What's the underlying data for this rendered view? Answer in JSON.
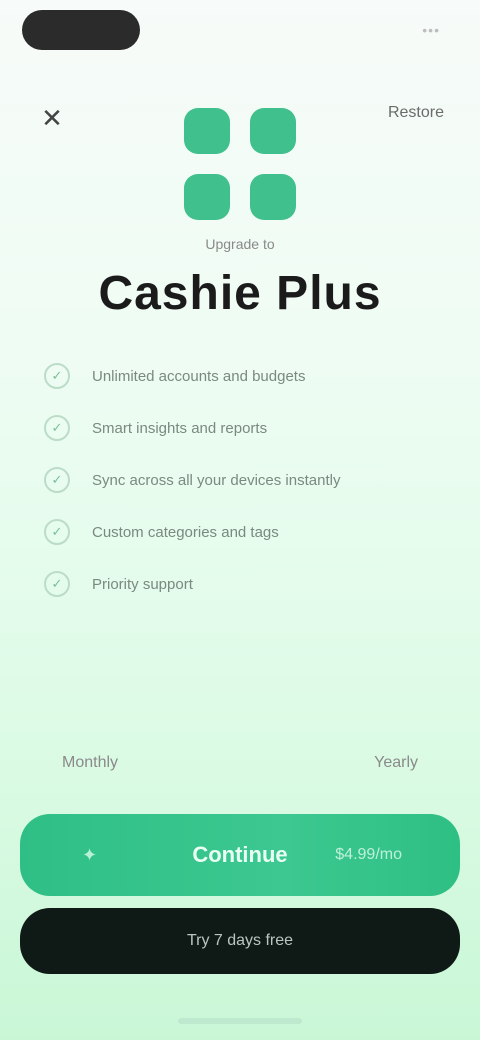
{
  "status": {
    "right": "•••"
  },
  "topbar": {
    "close_icon": "close-icon",
    "restore_label": "Restore"
  },
  "hero": {
    "kicker": "Upgrade to",
    "title": "Cashie Plus"
  },
  "features": [
    {
      "icon": "check-icon",
      "text": "Unlimited accounts and budgets"
    },
    {
      "icon": "check-icon",
      "text": "Smart insights and reports"
    },
    {
      "icon": "check-icon",
      "text": "Sync across all your devices instantly"
    },
    {
      "icon": "check-icon",
      "text": "Custom categories and tags"
    },
    {
      "icon": "check-icon",
      "text": "Priority support"
    }
  ],
  "plans": {
    "left": "Monthly",
    "right": "Yearly"
  },
  "cta": {
    "icon": "sparkle-icon",
    "label": "Continue",
    "price": "$4.99/mo"
  },
  "secondary": {
    "label": "Try 7 days free"
  },
  "colors": {
    "accent": "#3CC890",
    "dark": "#0F1A16"
  }
}
